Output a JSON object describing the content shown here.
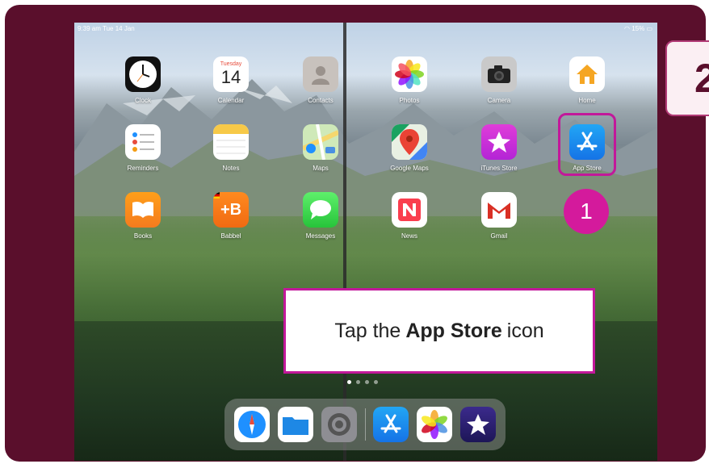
{
  "step": {
    "number": "2"
  },
  "status_bar": {
    "time": "9:39 am  Tue 14 Jan",
    "battery": "15%"
  },
  "calendar": {
    "weekday": "Tuesday",
    "day": "14"
  },
  "apps": [
    {
      "label": "Clock",
      "icon": "clock-icon"
    },
    {
      "label": "Calendar",
      "icon": "calendar-icon"
    },
    {
      "label": "Contacts",
      "icon": "contacts-icon"
    },
    {
      "label": "Photos",
      "icon": "photos-icon"
    },
    {
      "label": "Camera",
      "icon": "camera-icon"
    },
    {
      "label": "Home",
      "icon": "home-icon"
    },
    {
      "label": "Reminders",
      "icon": "reminders-icon"
    },
    {
      "label": "Notes",
      "icon": "notes-icon"
    },
    {
      "label": "Maps",
      "icon": "maps-icon"
    },
    {
      "label": "Google Maps",
      "icon": "google-maps-icon"
    },
    {
      "label": "iTunes Store",
      "icon": "itunes-store-icon"
    },
    {
      "label": "App Store",
      "icon": "app-store-icon"
    },
    {
      "label": "Books",
      "icon": "books-icon"
    },
    {
      "label": "Babbel",
      "icon": "babbel-icon"
    },
    {
      "label": "Messages",
      "icon": "messages-icon"
    },
    {
      "label": "News",
      "icon": "news-icon"
    },
    {
      "label": "Gmail",
      "icon": "gmail-icon"
    }
  ],
  "badge": {
    "number": "1"
  },
  "callout": {
    "prefix": "Tap the",
    "bold": "App Store",
    "suffix": "icon"
  },
  "page_dots": {
    "count": 4,
    "active": 1
  },
  "dock": {
    "apps": [
      "safari-icon",
      "files-icon",
      "settings-icon",
      "app-store-icon",
      "photos-icon",
      "imovie-icon"
    ]
  },
  "colors": {
    "frame": "#5a0f2c",
    "highlight": "#c2189a",
    "badge": "#d41a9c"
  }
}
